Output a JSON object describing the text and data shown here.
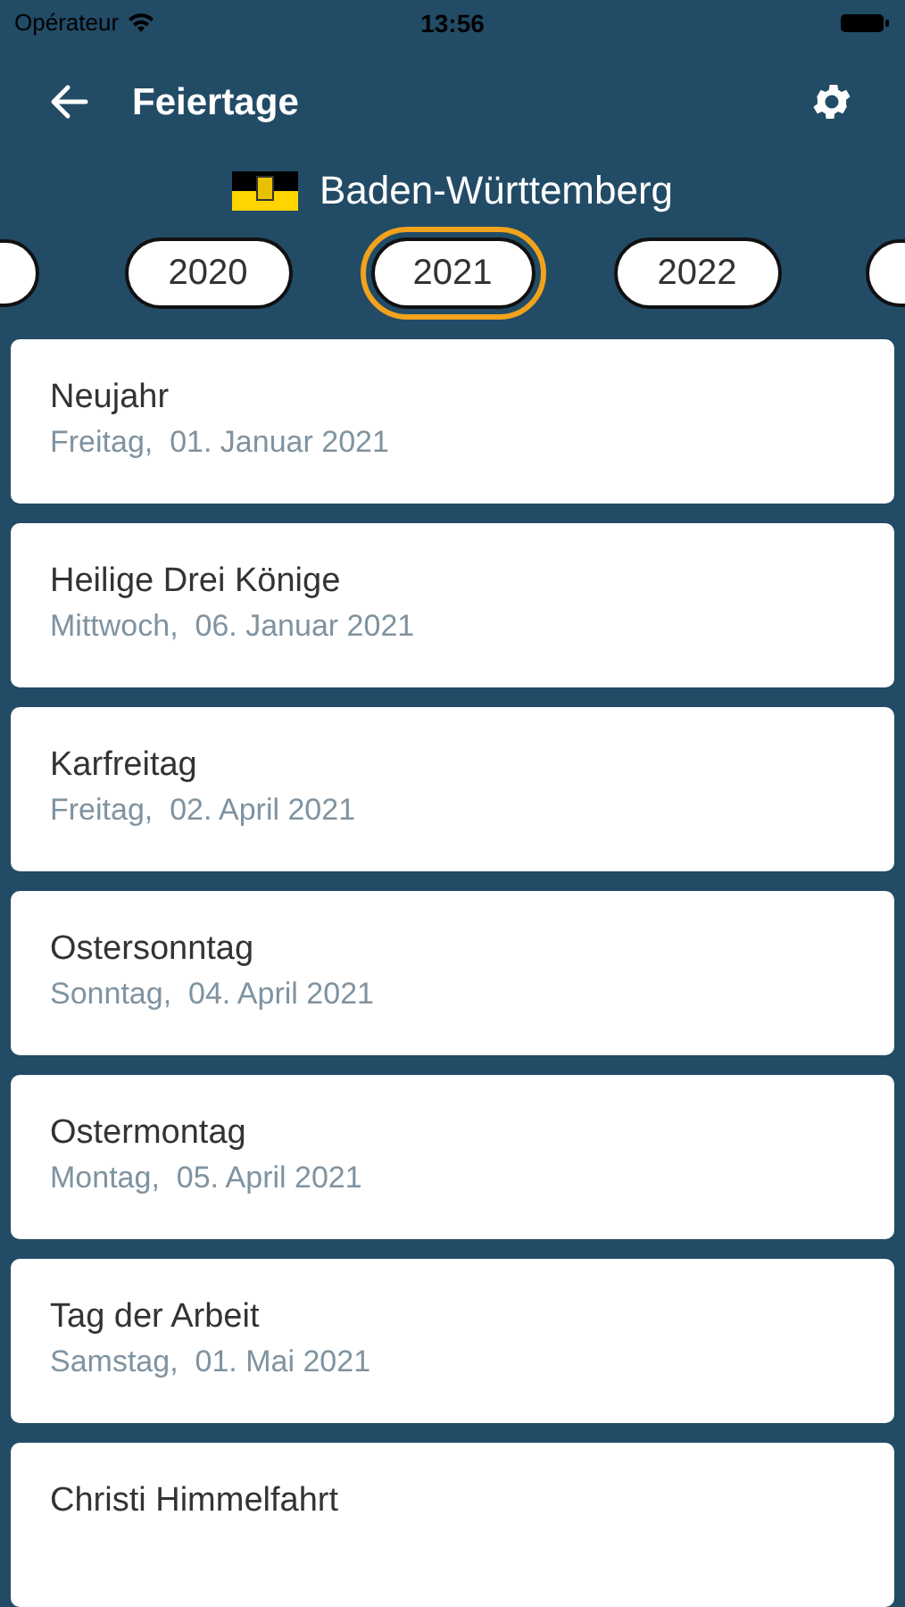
{
  "status_bar": {
    "carrier": "Opérateur",
    "time": "13:56"
  },
  "header": {
    "title": "Feiertage"
  },
  "region": {
    "name": "Baden-Württemberg"
  },
  "years": [
    {
      "label": "2020",
      "selected": false
    },
    {
      "label": "2021",
      "selected": true
    },
    {
      "label": "2022",
      "selected": false
    }
  ],
  "holidays": [
    {
      "name": "Neujahr",
      "date": "Freitag,  01. Januar 2021"
    },
    {
      "name": "Heilige Drei Könige",
      "date": "Mittwoch,  06. Januar 2021"
    },
    {
      "name": "Karfreitag",
      "date": "Freitag,  02. April 2021"
    },
    {
      "name": "Ostersonntag",
      "date": "Sonntag,  04. April 2021"
    },
    {
      "name": "Ostermontag",
      "date": "Montag,  05. April 2021"
    },
    {
      "name": "Tag der Arbeit",
      "date": "Samstag,  01. Mai 2021"
    },
    {
      "name": "Christi Himmelfahrt"
    }
  ]
}
